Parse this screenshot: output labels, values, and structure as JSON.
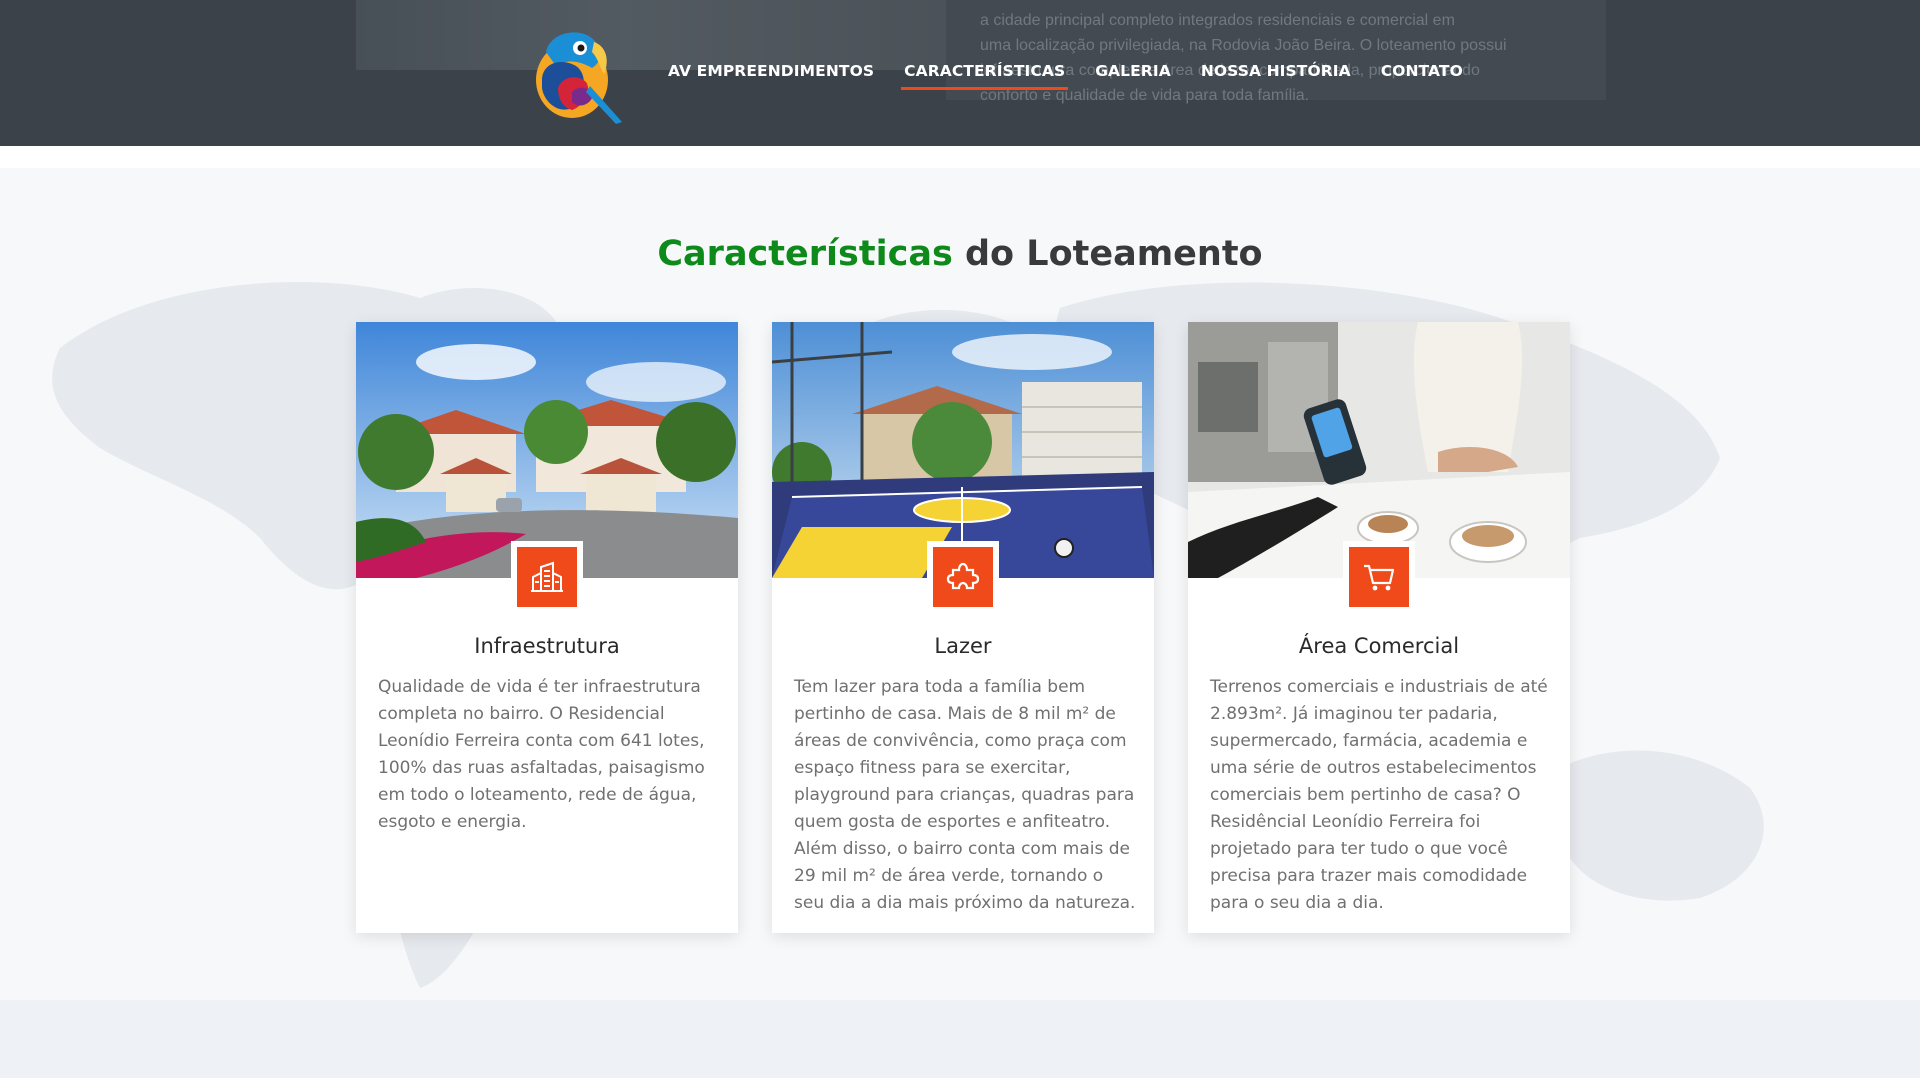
{
  "header": {
    "background_text": [
      "a cidade principal completo integrados residenciais e comercial em",
      "uma localização privilegiada, na Rodovia João Beira. O loteamento possui",
      "infraestrutura completa e área de lazer compartilhada, proporcionando",
      "conforto e qualidade de vida para toda família."
    ],
    "nav": [
      {
        "label": "AV EMPREENDIMENTOS",
        "active": false
      },
      {
        "label": "CARACTERÍSTICAS",
        "active": true
      },
      {
        "label": "GALERIA",
        "active": false
      },
      {
        "label": "NOSSA HISTÓRIA",
        "active": false
      },
      {
        "label": "CONTATO",
        "active": false
      }
    ],
    "logo_icon": "toucan-logo"
  },
  "section": {
    "title_highlight": "Características",
    "title_rest": " do Loteamento"
  },
  "cards": [
    {
      "title": "Infraestrutura",
      "icon": "building-icon",
      "text": "Qualidade de vida é ter infraestrutura completa no bairro. O Residencial Leonídio Ferreira conta com 641 lotes, 100% das ruas asfaltadas, paisagismo em todo o loteamento, rede de água, esgoto e energia."
    },
    {
      "title": "Lazer",
      "icon": "puzzle-icon",
      "text": "Tem lazer para toda a família bem pertinho de casa. Mais de 8 mil m² de áreas de convivência, como praça com espaço fitness para se exercitar, playground para crianças, quadras para quem gosta de esportes e anfiteatro. Além disso, o bairro conta com mais de 29 mil m² de área verde, tornando o seu dia a dia mais próximo da natureza."
    },
    {
      "title": "Área Comercial",
      "icon": "shopping-cart-icon",
      "text": "Terrenos comerciais e industriais de até 2.893m². Já imaginou ter padaria, supermercado, farmácia, academia e uma série de outros estabelecimentos comerciais bem pertinho de casa? O Residêncial Leonídio Ferreira foi projetado para ter tudo o que você precisa para trazer mais comodidade para o seu dia a dia."
    }
  ],
  "colors": {
    "header_bg": "#3b4249",
    "accent": "#f04a1a",
    "title_green": "#0d8a1a"
  }
}
